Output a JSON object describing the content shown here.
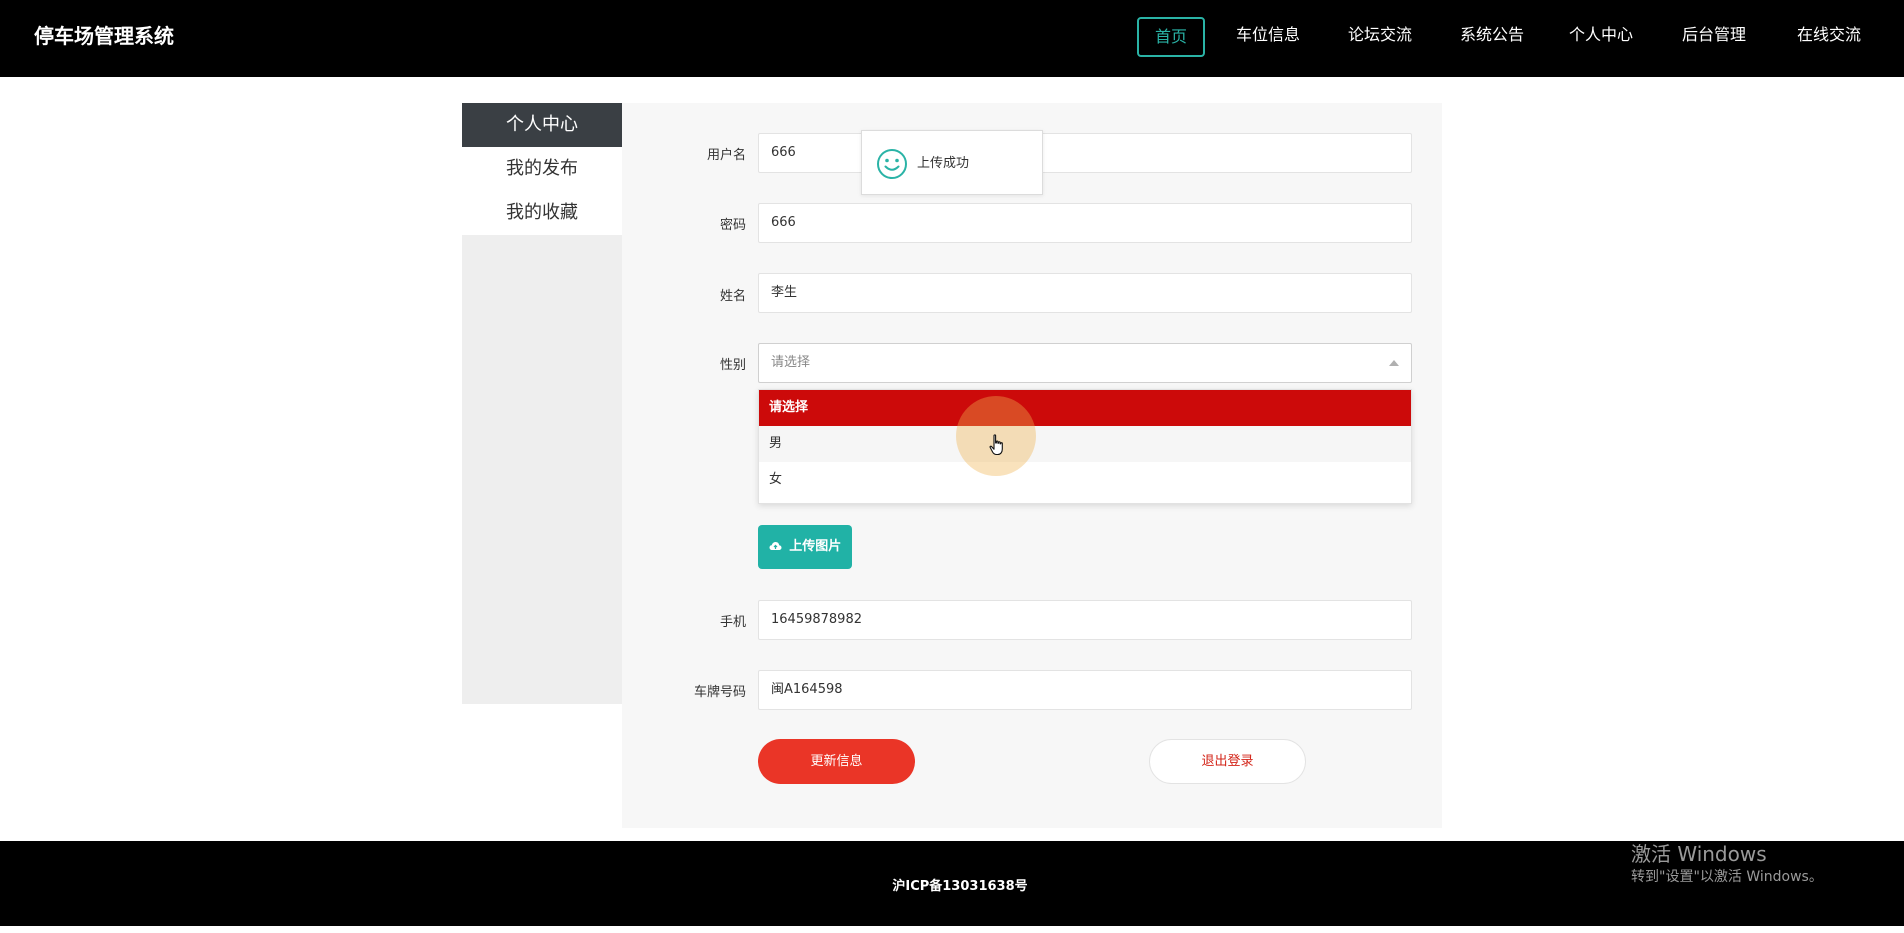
{
  "header": {
    "brand": "停车场管理系统",
    "nav": [
      {
        "label": "首页",
        "active": true
      },
      {
        "label": "车位信息"
      },
      {
        "label": "论坛交流"
      },
      {
        "label": "系统公告"
      },
      {
        "label": "个人中心"
      },
      {
        "label": "后台管理"
      },
      {
        "label": "在线交流"
      }
    ]
  },
  "sidebar": {
    "items": [
      {
        "label": "个人中心",
        "active": true
      },
      {
        "label": "我的发布"
      },
      {
        "label": "我的收藏"
      }
    ]
  },
  "form": {
    "username": {
      "label": "用户名",
      "value": "666"
    },
    "password": {
      "label": "密码",
      "value": "666"
    },
    "name": {
      "label": "姓名",
      "value": "李生"
    },
    "gender": {
      "label": "性别",
      "placeholder": "请选择",
      "options": [
        "请选择",
        "男",
        "女"
      ],
      "highlighted_option": "请选择"
    },
    "upload_button": "上传图片",
    "phone": {
      "label": "手机",
      "value": "16459878982"
    },
    "plate": {
      "label": "车牌号码",
      "value": "闽A164598"
    },
    "update_button": "更新信息",
    "logout_button": "退出登录"
  },
  "toast": {
    "text": "上传成功",
    "icon": "smile-icon"
  },
  "footer": {
    "icp": "沪ICP备13031638号"
  },
  "watermark": {
    "line1": "激活 Windows",
    "line2": "转到\"设置\"以激活 Windows。"
  },
  "colors": {
    "accent": "#2ab3a6",
    "danger": "#cc0a0a",
    "update_button": "#ea3527",
    "sidebar_active": "#3a3f44"
  }
}
